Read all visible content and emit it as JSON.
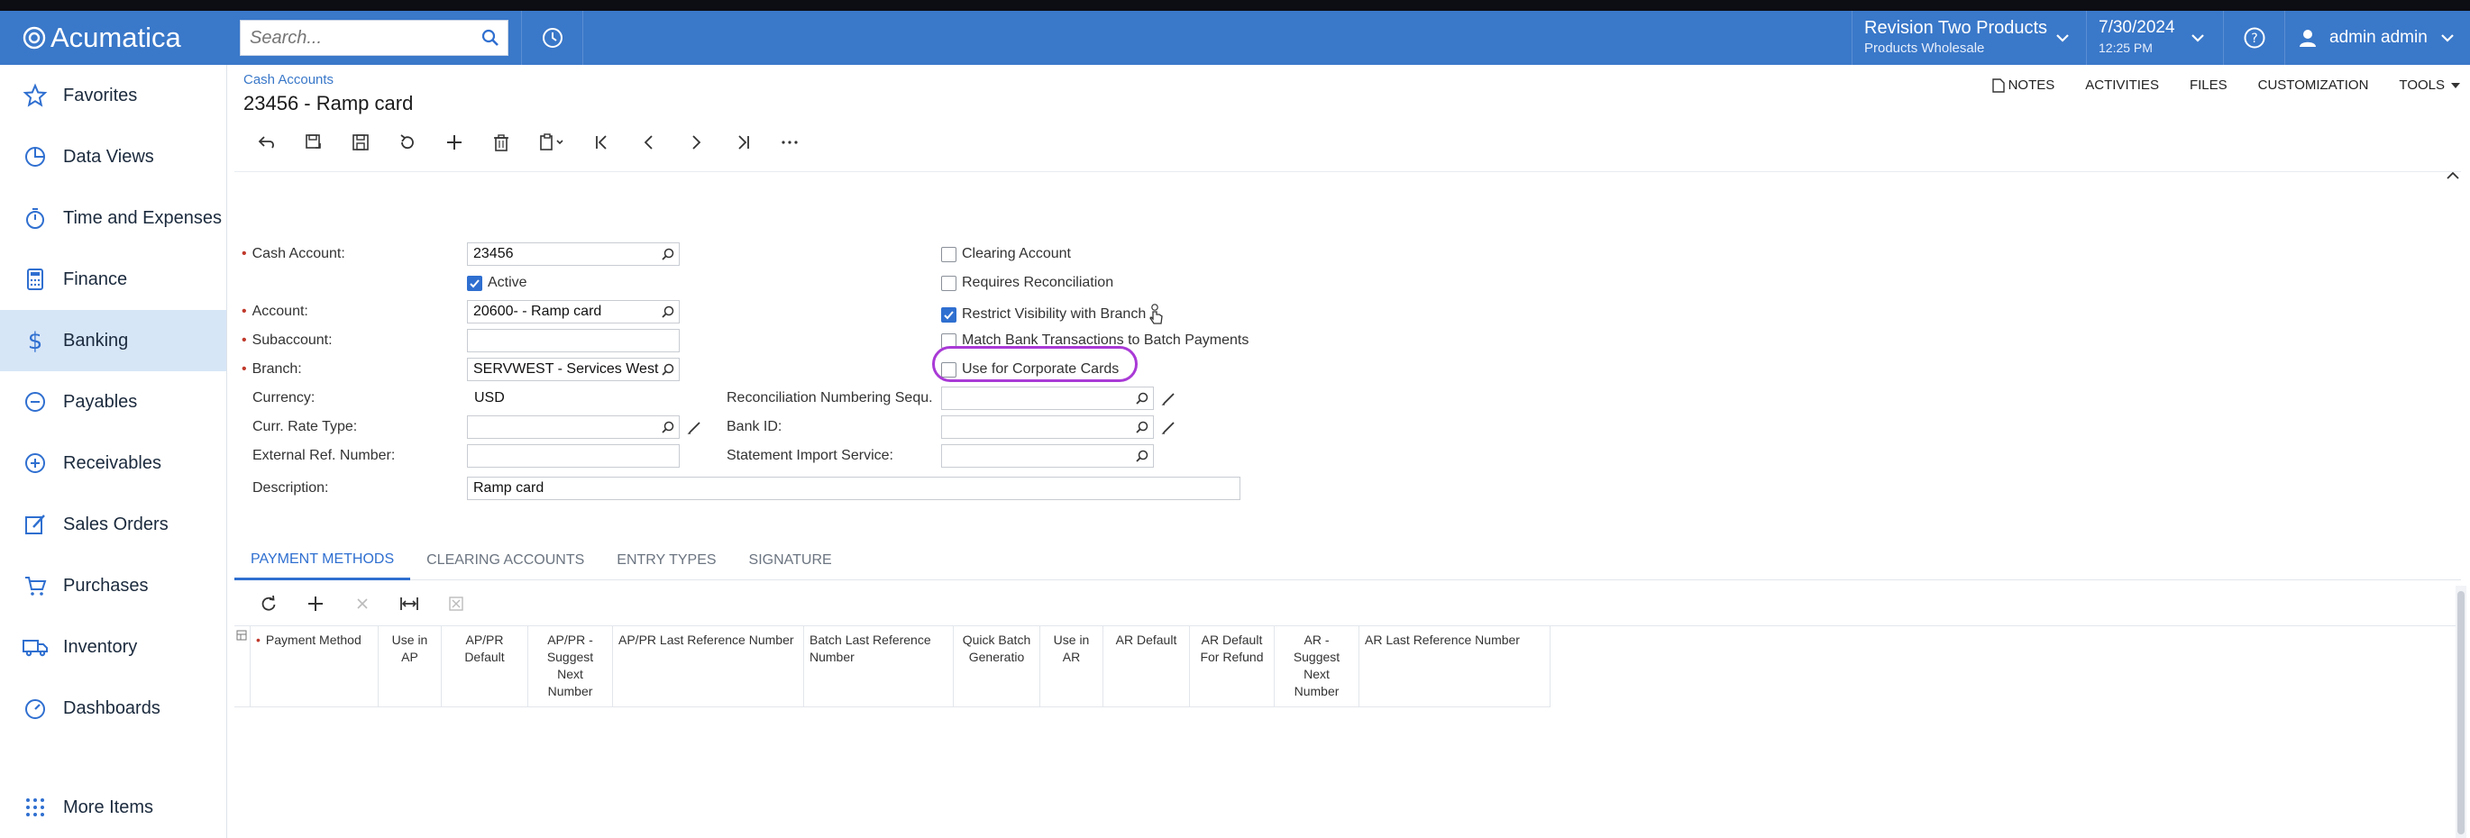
{
  "topbar": {
    "app_name": "Acumatica",
    "search_placeholder": "Search...",
    "branch_name": "Revision Two Products",
    "branch_sub": "Products Wholesale",
    "date": "7/30/2024",
    "time": "12:25 PM",
    "user_name": "admin admin",
    "accent": "#3a78c9"
  },
  "sidebar": {
    "items": [
      {
        "label": "Favorites",
        "icon": "star-icon"
      },
      {
        "label": "Data Views",
        "icon": "pie-chart-icon"
      },
      {
        "label": "Time and Expenses",
        "icon": "stopwatch-icon"
      },
      {
        "label": "Finance",
        "icon": "calculator-icon"
      },
      {
        "label": "Banking",
        "icon": "dollar-icon",
        "active": true
      },
      {
        "label": "Payables",
        "icon": "minus-circle-icon"
      },
      {
        "label": "Receivables",
        "icon": "plus-circle-icon"
      },
      {
        "label": "Sales Orders",
        "icon": "edit-icon"
      },
      {
        "label": "Purchases",
        "icon": "cart-icon"
      },
      {
        "label": "Inventory",
        "icon": "truck-icon"
      },
      {
        "label": "Dashboards",
        "icon": "gauge-icon"
      }
    ],
    "more_label": "More Items"
  },
  "page": {
    "breadcrumb": "Cash Accounts",
    "title": "23456 - Ramp card",
    "links": [
      "NOTES",
      "ACTIVITIES",
      "FILES",
      "CUSTOMIZATION",
      "TOOLS"
    ]
  },
  "form": {
    "cash_account_label": "Cash Account:",
    "cash_account_value": "23456",
    "active_label": "Active",
    "account_label": "Account:",
    "account_value": "20600- - Ramp card",
    "subaccount_label": "Subaccount:",
    "subaccount_value": "",
    "branch_label": "Branch:",
    "branch_value": "SERVWEST - Services West",
    "currency_label": "Currency:",
    "currency_value": "USD",
    "curr_rate_label": "Curr. Rate Type:",
    "curr_rate_value": "",
    "ext_ref_label": "External Ref. Number:",
    "ext_ref_value": "",
    "description_label": "Description:",
    "description_value": "Ramp card",
    "recon_seq_label": "Reconciliation Numbering Sequ...",
    "recon_seq_value": "",
    "bank_id_label": "Bank ID:",
    "bank_id_value": "",
    "stmt_import_label": "Statement Import Service:",
    "stmt_import_value": "",
    "clearing_account_label": "Clearing Account",
    "requires_reconciliation_label": "Requires Reconciliation",
    "restrict_visibility_label": "Restrict Visibility with Branch",
    "match_bank_label": "Match Bank Transactions to Batch Payments",
    "corporate_cards_label": "Use for Corporate Cards",
    "active_checked": true,
    "clearing_account_checked": false,
    "requires_reconciliation_checked": false,
    "restrict_visibility_checked": true,
    "match_bank_checked": false,
    "corporate_cards_checked": false
  },
  "tabs": [
    "PAYMENT METHODS",
    "CLEARING ACCOUNTS",
    "ENTRY TYPES",
    "SIGNATURE"
  ],
  "grid": {
    "columns": [
      "Payment Method",
      "Use in AP",
      "AP/PR Default",
      "AP/PR - Suggest Next Number",
      "AP/PR Last Reference Number",
      "Batch Last Reference Number",
      "Quick Batch Generatio",
      "Use in AR",
      "AR Default",
      "AR Default For Refund",
      "AR - Suggest Next Number",
      "AR Last Reference Number"
    ]
  }
}
